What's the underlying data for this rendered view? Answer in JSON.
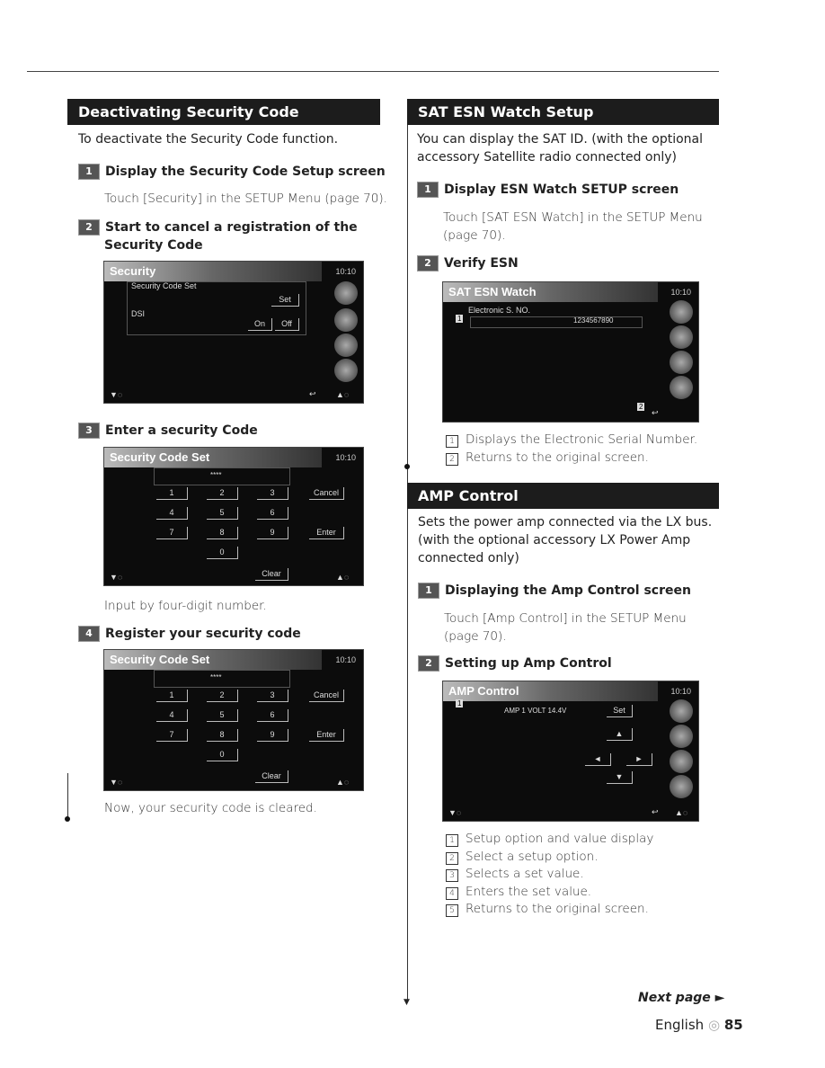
{
  "left": {
    "section1": {
      "title": "Deactivating Security Code",
      "intro": "To deactivate the Security Code function.",
      "steps": [
        {
          "num": "1",
          "title": "Display the Security Code Setup screen",
          "text": "Touch [Security] in the SETUP Menu (page 70)."
        },
        {
          "num": "2",
          "title": "Start to cancel a registration of the",
          "title2": "Security Code"
        },
        {
          "num": "3",
          "title": "Enter a security Code",
          "text": "Input by four-digit number."
        },
        {
          "num": "4",
          "title": "Register your security code",
          "text": "Now, your security code is cleared."
        }
      ]
    },
    "security_screen": {
      "title": "Security",
      "clock": "10:10",
      "row1": "Security Code Set",
      "set": "Set",
      "row2": "DSI",
      "on": "On",
      "off": "Off"
    },
    "keypad_screen": {
      "title": "Security Code Set",
      "clock": "10:10",
      "code": "****",
      "keys": [
        "1",
        "2",
        "3",
        "4",
        "5",
        "6",
        "7",
        "8",
        "9",
        "0"
      ],
      "cancel": "Cancel",
      "enter": "Enter",
      "clear": "Clear"
    }
  },
  "right": {
    "section1": {
      "title": "SAT ESN Watch Setup",
      "intro": "You can display the SAT ID. (with the optional",
      "intro2": "accessory Satellite radio connected only)",
      "steps": [
        {
          "num": "1",
          "title": "Display ESN Watch SETUP screen",
          "text": "Touch [SAT ESN Watch] in the SETUP Menu",
          "text2": "(page 70)."
        },
        {
          "num": "2",
          "title": "Verify ESN"
        }
      ],
      "legend": [
        "Displays the Electronic Serial Number.",
        "Returns to the original screen."
      ]
    },
    "esn_screen": {
      "title": "SAT ESN Watch",
      "clock": "10:10",
      "label": "Electronic S. NO.",
      "value": "1234567890"
    },
    "section2": {
      "title": "AMP Control",
      "intro": "Sets the power amp connected via the LX bus.",
      "intro2": "(with the optional accessory LX Power Amp",
      "intro3": "connected only)",
      "steps": [
        {
          "num": "1",
          "title": "Displaying the Amp Control screen",
          "text": "Touch [Amp Control] in the SETUP Menu",
          "text2": "(page 70)."
        },
        {
          "num": "2",
          "title": "Setting up Amp Control"
        }
      ],
      "legend": [
        "Setup option and value display",
        "Select a setup option.",
        "Selects a set value.",
        "Enters the set value.",
        "Returns to the original screen."
      ]
    },
    "amp_screen": {
      "title": "AMP Control",
      "clock": "10:10",
      "value": "AMP 1 VOLT 14.4V",
      "set": "Set"
    }
  },
  "footer": {
    "next": "Next page ►",
    "lang": "English",
    "page": "85"
  }
}
